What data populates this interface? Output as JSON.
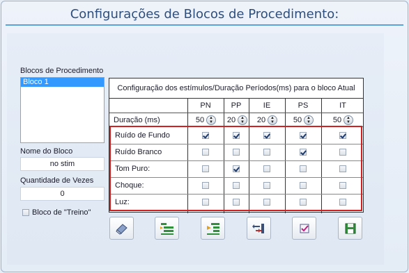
{
  "title": "Configurações de Blocos de Procedimento:",
  "blocks_list": {
    "label": "Blocos de Procedimento",
    "items": [
      "Bloco 1"
    ]
  },
  "block_name": {
    "label": "Nome do Bloco",
    "value": "no stim"
  },
  "repeat_count": {
    "label": "Quantidade de Vezes",
    "value": "0"
  },
  "training_block": {
    "label": "Bloco de \"Treino\"",
    "checked": false
  },
  "config_table": {
    "caption": "Configuração dos estímulos/Duração Períodos(ms) para o bloco Atual",
    "columns": [
      "PN",
      "PP",
      "IE",
      "PS",
      "IT"
    ],
    "duration_label": "Duração (ms)",
    "durations": [
      "50",
      "20",
      "20",
      "50",
      "50"
    ],
    "rows": [
      {
        "label": "Ruído de Fundo",
        "checks": [
          true,
          true,
          true,
          true,
          true
        ]
      },
      {
        "label": "Ruído Branco",
        "checks": [
          false,
          false,
          false,
          true,
          false
        ]
      },
      {
        "label": "Tom Puro:",
        "checks": [
          false,
          true,
          false,
          false,
          false
        ]
      },
      {
        "label": "Choque:",
        "checks": [
          false,
          false,
          false,
          false,
          false
        ]
      },
      {
        "label": "Luz:",
        "checks": [
          false,
          false,
          false,
          false,
          false
        ]
      }
    ]
  },
  "toolbar": [
    {
      "icon": "eraser-icon"
    },
    {
      "icon": "add-block-icon"
    },
    {
      "icon": "insert-block-icon"
    },
    {
      "icon": "move-block-icon"
    },
    {
      "icon": "check-list-icon"
    },
    {
      "icon": "save-icon"
    }
  ],
  "colors": {
    "title": "#2e4e7d",
    "accent_line": "#5aa2d8",
    "selection": "#3399ff",
    "highlight_border": "#d02020"
  }
}
